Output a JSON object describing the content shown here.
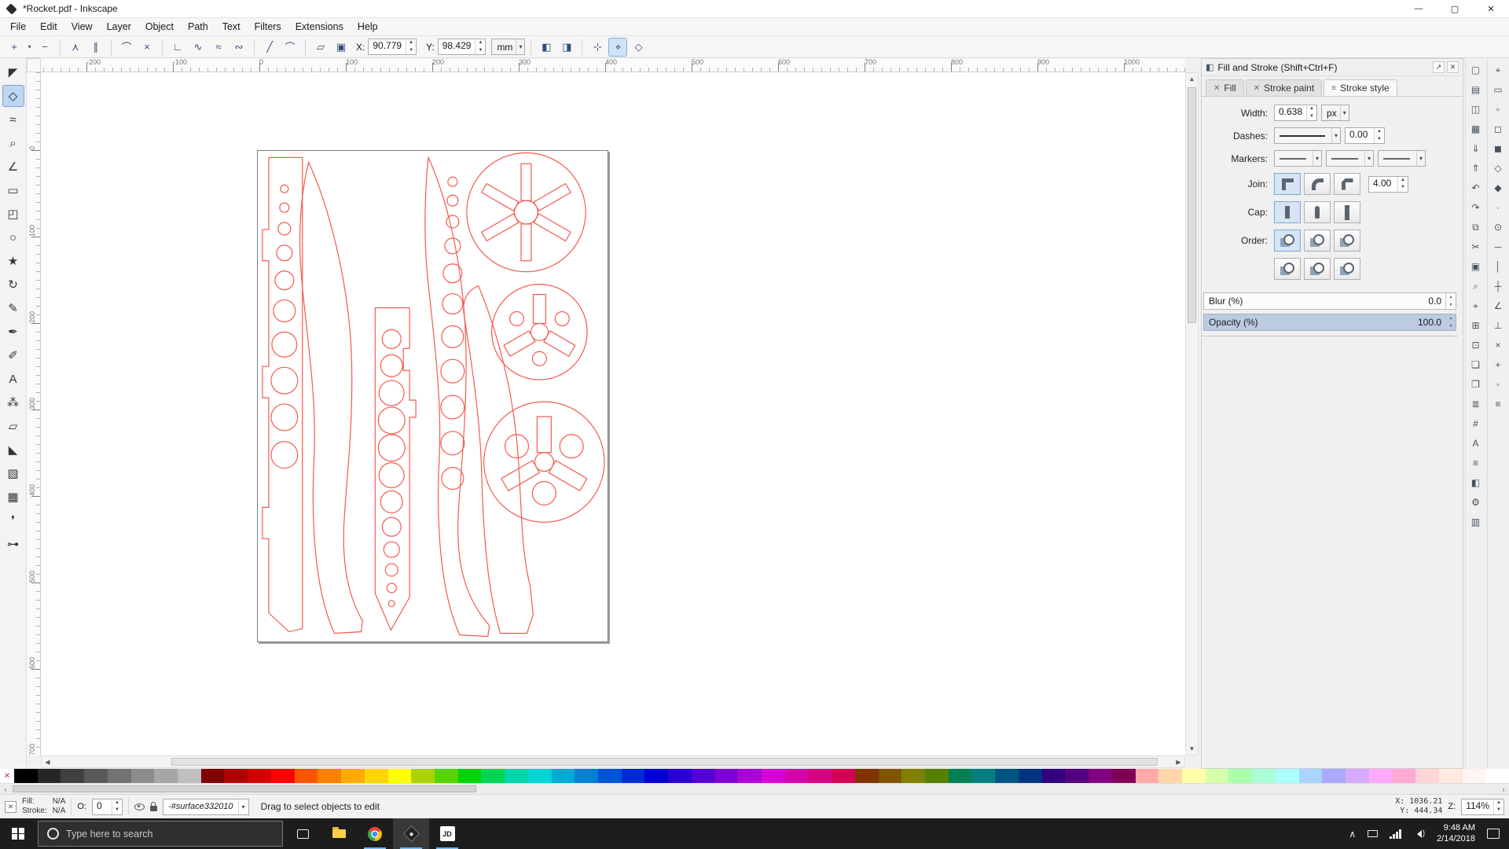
{
  "window": {
    "title": "*Rocket.pdf - Inkscape",
    "minimize": "—",
    "maximize": "▢",
    "close": "✕"
  },
  "menu": {
    "items": [
      "File",
      "Edit",
      "View",
      "Layer",
      "Object",
      "Path",
      "Text",
      "Filters",
      "Extensions",
      "Help"
    ]
  },
  "node_toolbar": {
    "left_buttons": [
      {
        "name": "insert-nodes-button",
        "glyph": "+"
      },
      {
        "name": "insert-nodes-menu-arrow",
        "glyph": "▾",
        "small": true
      },
      {
        "name": "delete-nodes-button",
        "glyph": "−"
      },
      {
        "sep": true
      },
      {
        "name": "join-nodes-button",
        "glyph": "⋏"
      },
      {
        "name": "break-nodes-button",
        "glyph": "∥"
      },
      {
        "sep": true
      },
      {
        "name": "join-with-segment-button",
        "glyph": "⌒"
      },
      {
        "name": "delete-segment-button",
        "glyph": "×"
      },
      {
        "sep": true
      },
      {
        "name": "node-corner-button",
        "glyph": "∟"
      },
      {
        "name": "node-smooth-button",
        "glyph": "∿"
      },
      {
        "name": "node-symmetric-button",
        "glyph": "≈"
      },
      {
        "name": "node-auto-button",
        "glyph": "∾"
      },
      {
        "sep": true
      },
      {
        "name": "segment-line-button",
        "glyph": "╱"
      },
      {
        "name": "segment-curve-button",
        "glyph": "⌒"
      },
      {
        "sep": true
      },
      {
        "name": "object-to-path-button",
        "glyph": "▱"
      },
      {
        "name": "stroke-to-path-button",
        "glyph": "▣"
      }
    ],
    "x_label": "X:",
    "x_value": "90.779",
    "y_label": "Y:",
    "y_value": "98.429",
    "unit": "mm",
    "right_buttons": [
      {
        "sep": true
      },
      {
        "name": "edit-clip-button",
        "glyph": "◧"
      },
      {
        "name": "edit-mask-button",
        "glyph": "◨"
      },
      {
        "sep": true
      },
      {
        "name": "show-transform-handles-button",
        "glyph": "⊹"
      },
      {
        "name": "show-handles-button",
        "glyph": "⌖",
        "active": true
      },
      {
        "name": "show-outline-button",
        "glyph": "◇"
      }
    ]
  },
  "toolbox": {
    "tools": [
      {
        "name": "selector-tool",
        "glyph": "◤"
      },
      {
        "name": "node-tool",
        "glyph": "◇",
        "active": true
      },
      {
        "name": "tweak-tool",
        "glyph": "≈"
      },
      {
        "name": "zoom-tool",
        "glyph": "⌕"
      },
      {
        "name": "measure-tool",
        "glyph": "∠"
      },
      {
        "name": "rectangle-tool",
        "glyph": "▭"
      },
      {
        "name": "box3d-tool",
        "glyph": "◰"
      },
      {
        "name": "ellipse-tool",
        "glyph": "○"
      },
      {
        "name": "star-tool",
        "glyph": "★"
      },
      {
        "name": "spiral-tool",
        "glyph": "↻"
      },
      {
        "name": "pencil-tool",
        "glyph": "✎"
      },
      {
        "name": "bezier-tool",
        "glyph": "✒"
      },
      {
        "name": "calligraphy-tool",
        "glyph": "✐"
      },
      {
        "name": "text-tool",
        "glyph": "A"
      },
      {
        "name": "spray-tool",
        "glyph": "⁂"
      },
      {
        "name": "eraser-tool",
        "glyph": "▱"
      },
      {
        "name": "bucket-tool",
        "glyph": "◣"
      },
      {
        "name": "gradient-tool",
        "glyph": "▧"
      },
      {
        "name": "mesh-tool",
        "glyph": "▦"
      },
      {
        "name": "dropper-tool",
        "glyph": "❜"
      },
      {
        "name": "connector-tool",
        "glyph": "⊶"
      }
    ]
  },
  "rulers": {
    "h_start": -200,
    "h_end": 1100,
    "v_start": 0,
    "v_end": 700,
    "step": 100
  },
  "canvas": {
    "outline_color": "#f25a50"
  },
  "fill_stroke": {
    "title": "Fill and Stroke (Shift+Ctrl+F)",
    "title_icon": "◧",
    "float_button": "↗",
    "close_button": "✕",
    "tabs": [
      {
        "label": "Fill",
        "icon": "✕"
      },
      {
        "label": "Stroke paint",
        "icon": "✕"
      },
      {
        "label": "Stroke style",
        "icon": "≡",
        "active": true
      }
    ],
    "width": {
      "label": "Width:",
      "value": "0.638",
      "unit": "px"
    },
    "dashes": {
      "label": "Dashes:",
      "offset": "0.00"
    },
    "markers": {
      "label": "Markers:"
    },
    "join": {
      "label": "Join:",
      "miter_limit": "4.00"
    },
    "cap": {
      "label": "Cap:"
    },
    "order": {
      "label": "Order:"
    },
    "blur": {
      "label": "Blur (%)",
      "value": "0.0"
    },
    "opacity": {
      "label": "Opacity (%)",
      "value": "100.0"
    }
  },
  "commands_bar": {
    "buttons": [
      {
        "name": "new-document-button",
        "glyph": "▢"
      },
      {
        "name": "open-document-button",
        "glyph": "▤"
      },
      {
        "name": "save-document-button",
        "glyph": "◫"
      },
      {
        "name": "print-button",
        "glyph": "▦"
      },
      {
        "name": "import-button",
        "glyph": "⇓"
      },
      {
        "name": "export-button",
        "glyph": "⇑"
      },
      {
        "name": "undo-button",
        "glyph": "↶"
      },
      {
        "name": "redo-button",
        "glyph": "↷"
      },
      {
        "name": "copy-button",
        "glyph": "⧉"
      },
      {
        "name": "cut-button",
        "glyph": "✂"
      },
      {
        "name": "paste-button",
        "glyph": "▣"
      },
      {
        "name": "zoom-drawing-button",
        "glyph": "⌕"
      },
      {
        "name": "zoom-page-button",
        "glyph": "⌖"
      },
      {
        "name": "duplicate-button",
        "glyph": "⊞"
      },
      {
        "name": "clone-button",
        "glyph": "⊡"
      },
      {
        "name": "group-button",
        "glyph": "❏"
      },
      {
        "name": "ungroup-button",
        "glyph": "❐"
      },
      {
        "name": "layers-dialog-button",
        "glyph": "≣"
      },
      {
        "name": "xml-editor-button",
        "glyph": "#"
      },
      {
        "name": "text-dialog-button",
        "glyph": "A"
      },
      {
        "name": "align-dialog-button",
        "glyph": "≡"
      },
      {
        "name": "fill-stroke-dialog-button",
        "glyph": "◧"
      },
      {
        "name": "preferences-button",
        "glyph": "⚙"
      },
      {
        "name": "document-properties-button",
        "glyph": "▥"
      }
    ]
  },
  "snap_bar": {
    "buttons": [
      {
        "name": "snap-enable-toggle",
        "glyph": "⌖"
      },
      {
        "name": "snap-bbox-toggle",
        "glyph": "▭"
      },
      {
        "name": "snap-bbox-edge-toggle",
        "glyph": "▫"
      },
      {
        "name": "snap-bbox-corner-toggle",
        "glyph": "◻"
      },
      {
        "name": "snap-bbox-midpoint-toggle",
        "glyph": "◼"
      },
      {
        "name": "snap-node-toggle",
        "glyph": "◇"
      },
      {
        "name": "snap-path-toggle",
        "glyph": "◆"
      },
      {
        "name": "snap-path-intersection-toggle",
        "glyph": "∙"
      },
      {
        "name": "snap-node-cusp-toggle",
        "glyph": "⊙"
      },
      {
        "name": "snap-smooth-node-toggle",
        "glyph": "─"
      },
      {
        "name": "snap-line-midpoint-toggle",
        "glyph": "│"
      },
      {
        "name": "snap-object-center-toggle",
        "glyph": "┼"
      },
      {
        "name": "snap-rotation-center-toggle",
        "glyph": "∠"
      },
      {
        "name": "snap-text-baseline-toggle",
        "glyph": "⊥"
      },
      {
        "name": "snap-page-border-toggle",
        "glyph": "×"
      },
      {
        "name": "snap-grid-toggle",
        "glyph": "+"
      },
      {
        "name": "snap-guide-toggle",
        "glyph": "◦"
      },
      {
        "name": "snap-others-toggle",
        "glyph": "≡"
      }
    ]
  },
  "palette": {
    "colors": [
      "none",
      "#000000",
      "#262626",
      "#404040",
      "#595959",
      "#737373",
      "#8c8c8c",
      "#a6a6a6",
      "#bfbfbf",
      "#800000",
      "#aa0000",
      "#d40000",
      "#ff0000",
      "#ff5500",
      "#ff8000",
      "#ffaa00",
      "#ffd500",
      "#ffff00",
      "#aad400",
      "#55d400",
      "#00d400",
      "#00d455",
      "#00d4aa",
      "#00d4d4",
      "#00aad4",
      "#0080d4",
      "#0055d4",
      "#002bd4",
      "#0000d4",
      "#2b00d4",
      "#5500d4",
      "#8000d4",
      "#aa00d4",
      "#d400d4",
      "#d400aa",
      "#d40080",
      "#d40055",
      "#803300",
      "#805500",
      "#808000",
      "#558000",
      "#008055",
      "#008080",
      "#005580",
      "#003380",
      "#330080",
      "#550080",
      "#800080",
      "#800055",
      "#ffaaaa",
      "#ffd5aa",
      "#ffffaa",
      "#d5ffaa",
      "#aaffaa",
      "#aaffd5",
      "#aaffff",
      "#aad5ff",
      "#aaaaff",
      "#d5aaff",
      "#ffaaff",
      "#ffaad5",
      "#ffd5d5",
      "#ffe9e0",
      "#fff5f0",
      "#ffffff"
    ]
  },
  "statusbar": {
    "fill_label": "Fill:",
    "fill_value": "N/A",
    "stroke_label": "Stroke:",
    "stroke_value": "N/A",
    "opacity_label": "O:",
    "opacity_value": "0",
    "layer": "-#surface332010",
    "message": "Drag to select objects to edit",
    "x": "X: 1036.21",
    "y": "Y: 444.34",
    "zoom_label": "Z:",
    "zoom": "114%"
  },
  "taskbar": {
    "search_placeholder": "Type here to search",
    "jd_label": "JD",
    "time": "9:48 AM",
    "date": "2/14/2018"
  }
}
